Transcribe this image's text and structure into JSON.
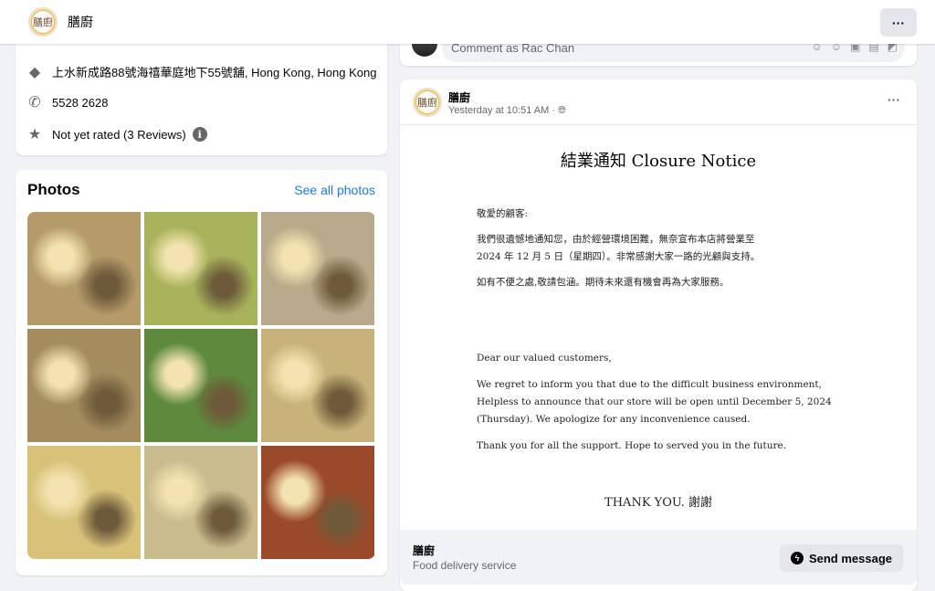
{
  "header": {
    "page_name": "膳廚",
    "logo_text": "膳廚",
    "more_label": "···"
  },
  "info": {
    "address": "上水新成路88號海禧華庭地下55號舖, Hong Kong, Hong Kong",
    "phone": "5528 2628",
    "rating": "Not yet rated (3 Reviews)",
    "info_icon": "i"
  },
  "photos": {
    "title": "Photos",
    "see_all": "See all photos",
    "tiles": [
      "#b59a6a",
      "#a7b25a",
      "#b8a98a",
      "#a48c5e",
      "#5f8a3e",
      "#c8b27a",
      "#d8c27a",
      "#c9bb8e",
      "#9a4a2a"
    ]
  },
  "comment": {
    "placeholder": "Comment as Rac Chan",
    "icons": [
      "avatar-sticker-icon",
      "emoji-icon",
      "camera-icon",
      "gif-icon",
      "sticker-icon"
    ]
  },
  "post": {
    "author": "膳廚",
    "time": "Yesterday at 10:51 AM · ",
    "more": "···",
    "notice": {
      "title": "結業通知  Closure Notice",
      "salutation_zh": "敬愛的顧客:",
      "body_zh": "我們很遺憾地通知您，由於經營環境困難，無奈宣布本店將營業至 2024 年 12 月 5 日（星期四）。非常感謝大家一路的光顧與支持。",
      "apology_zh": "如有不便之處,敬請包涵。期待未來還有機會再為大家服務。",
      "salutation_en": "Dear our valued customers,",
      "body_en": "We regret to inform you that due to the difficult business environment, Helpless to announce that our store will be open until December 5, 2024 (Thursday). We apologize for any inconvenience caused.",
      "thanks_en": "Thank you for all the support. Hope to served you in the future.",
      "signoff": "THANK YOU. 謝謝"
    }
  },
  "footer": {
    "name": "膳廚",
    "category": "Food delivery service",
    "send_label": "Send message"
  }
}
